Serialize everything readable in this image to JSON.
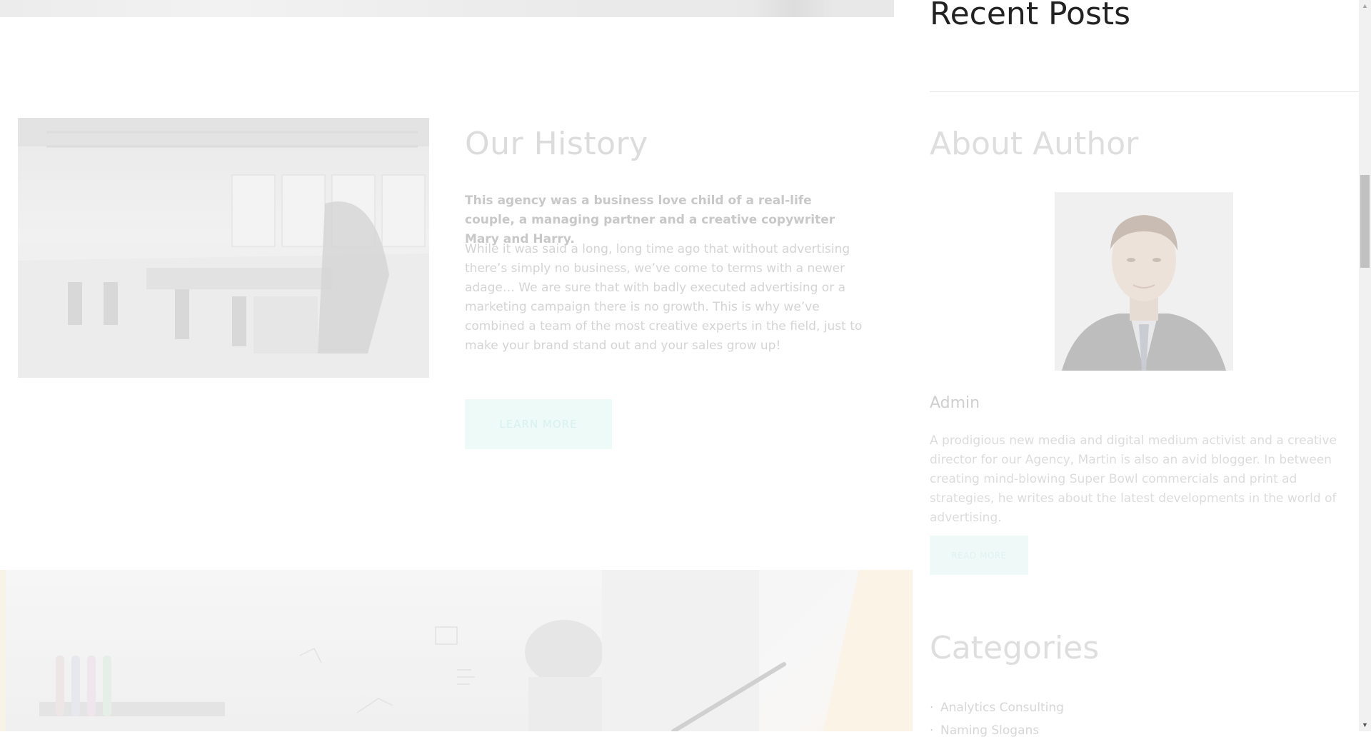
{
  "history": {
    "title": "Our History",
    "lead": "This agency was a business love child of a real-life couple, a managing partner and a creative copywriter Mary and Harry.",
    "body": "While it was said a long, long time ago that without advertising there’s simply no business, we’ve come to terms with a newer adage… We are sure that with badly executed advertising or a marketing campaign there is no growth. This is why we’ve combined a team of the most creative experts in the field, just to make your brand stand out and your sales grow up!",
    "button_label": "LEARN MORE"
  },
  "sidebar": {
    "recent_posts_title": "Recent Posts",
    "about_title": "About Author",
    "author_name": "Admin",
    "author_bio": "A prodigious new media and digital medium activist and a creative director for our Agency, Martin is also an avid blogger. In between creating mind-blowing Super Bowl commercials and print ad strategies, he writes about the latest developments in the world of advertising.",
    "read_more_label": "READ MORE",
    "categories_title": "Categories",
    "categories": [
      "Analytics Consulting",
      "Naming Slogans"
    ]
  },
  "colors": {
    "accent": "#1abc9c",
    "heading_dark": "#222222"
  }
}
